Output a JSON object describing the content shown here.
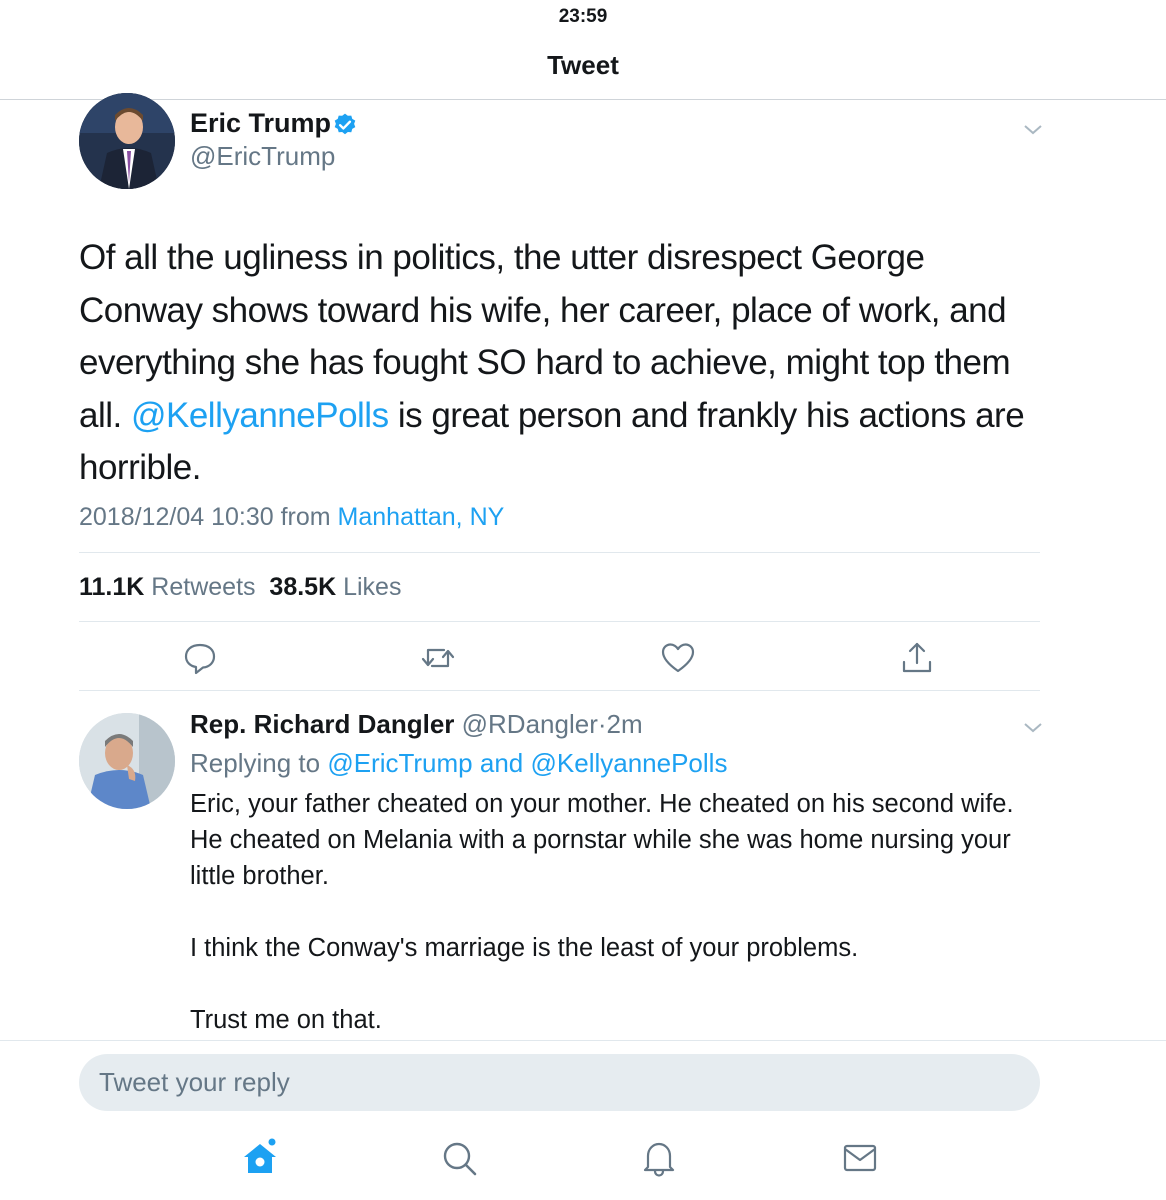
{
  "status_bar": {
    "time": "23:59"
  },
  "nav": {
    "title": "Tweet"
  },
  "main_tweet": {
    "author": {
      "name": "Eric Trump",
      "handle": "@EricTrump",
      "verified": true,
      "avatar": "person-photo"
    },
    "text_before": "Of all the ugliness in politics, the utter disrespect George Conway shows toward his wife, her career, place of work, and everything she has fought SO hard to achieve, might top them all. ",
    "mention": "@KellyannePolls",
    "text_after": " is great person and frankly his actions are horrible.",
    "timestamp": "2018/12/04 10:30",
    "from_label": "from",
    "location": "Manhattan, NY",
    "retweets_count": "11.1K",
    "retweets_label": "Retweets",
    "likes_count": "38.5K",
    "likes_label": "Likes"
  },
  "actions": [
    "reply-icon",
    "retweet-icon",
    "like-icon",
    "share-icon"
  ],
  "reply_tweet": {
    "author": {
      "name": "Rep. Richard Dangler",
      "handle": "@RDangler",
      "time": "2m",
      "avatar": "person-photo"
    },
    "replying_prefix": "Replying to",
    "replying_to_1": "@EricTrump",
    "replying_and": "and",
    "replying_to_2": "@KellyannePolls",
    "paragraph_1": "Eric, your father cheated on your mother. He cheated on his second wife. He cheated on Melania with a pornstar while she was home nursing your little brother.",
    "paragraph_2": "I think the Conway's marriage is the least of your problems.",
    "paragraph_3": "Trust me on that."
  },
  "reply_box": {
    "placeholder": "Tweet your reply"
  },
  "tab_bar": [
    "home-icon",
    "search-icon",
    "notifications-icon",
    "messages-icon"
  ],
  "colors": {
    "accent": "#1da1f2",
    "secondary_text": "#657786",
    "primary_text": "#14171a"
  }
}
